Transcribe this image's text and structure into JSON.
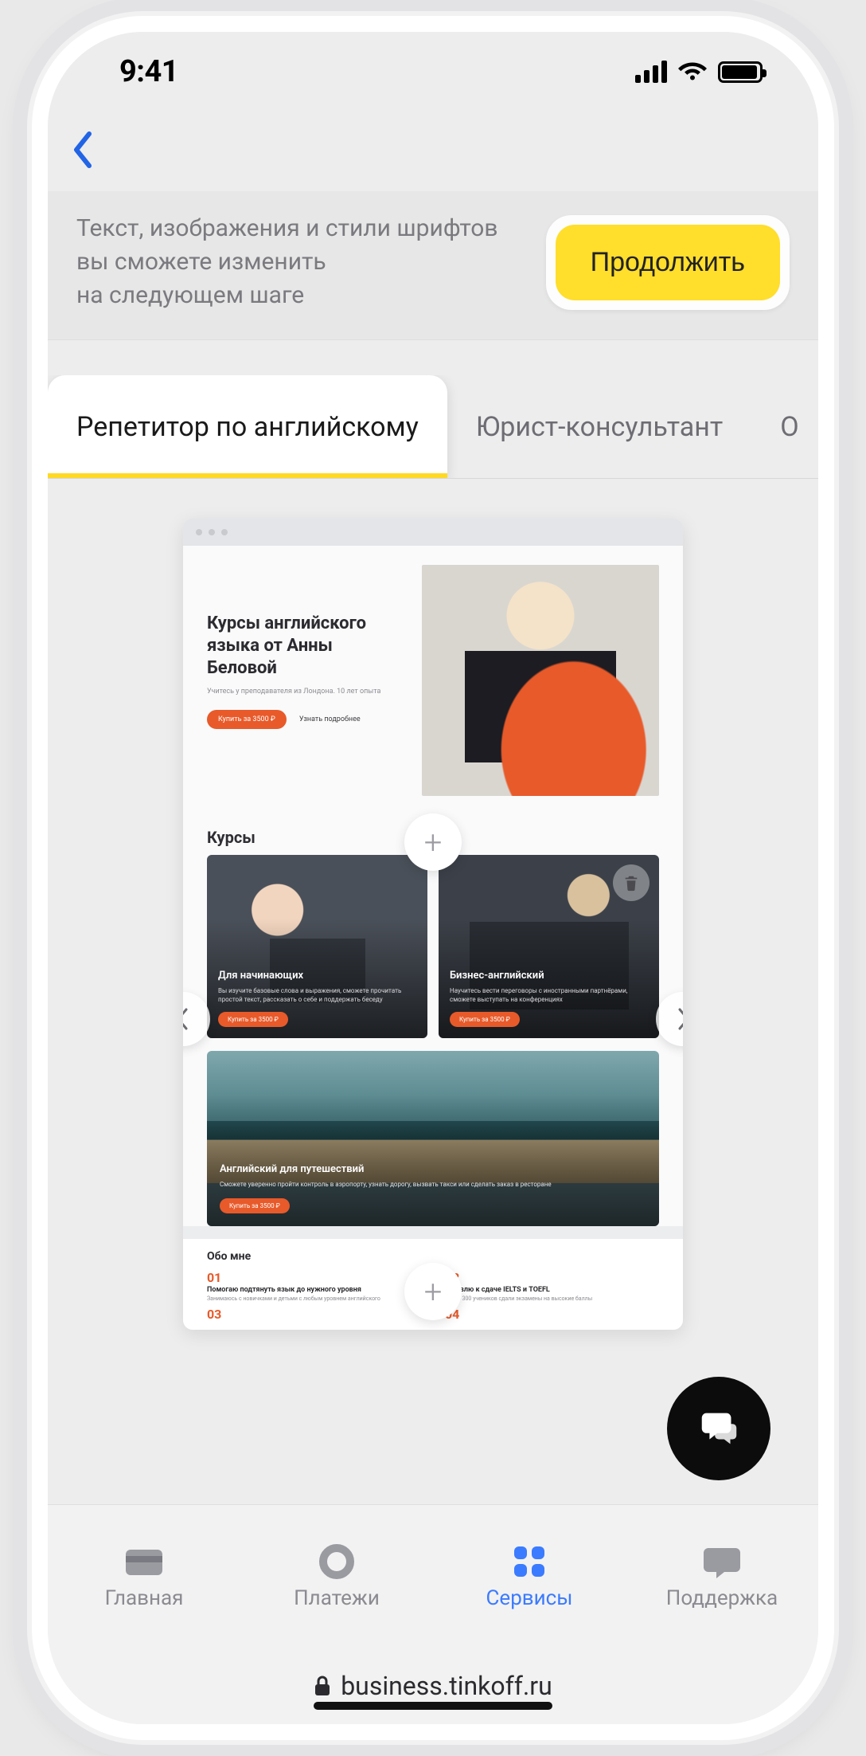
{
  "status": {
    "time": "9:41"
  },
  "banner": {
    "text_lines": [
      "Текст, изображения и стили шрифтов",
      "вы сможете изменить",
      "на следующем шаге"
    ],
    "continue_label": "Продолжить"
  },
  "tabs": {
    "items": [
      {
        "label": "Репетитор по английскому",
        "active": true
      },
      {
        "label": "Юрист-консультант",
        "active": false
      },
      {
        "label": "О",
        "active": false
      }
    ]
  },
  "preview": {
    "hero": {
      "title": "Курсы английского языка от Анны Беловой",
      "subtitle": "Учитесь у преподавателя из Лондона. 10 лет опыта",
      "primary_btn": "Купить за 3500 ₽",
      "secondary_btn": "Узнать подробнее"
    },
    "courses_heading": "Курсы",
    "courses": [
      {
        "title": "Для начинающих",
        "desc": "Вы изучите базовые слова и выражения, сможете прочитать простой текст, рассказать о себе и поддержать беседу",
        "btn": "Купить за 3500 ₽"
      },
      {
        "title": "Бизнес-английский",
        "desc": "Научитесь вести переговоры с иностранными партнёрами, сможете выступать на конференциях",
        "btn": "Купить за 3500 ₽"
      }
    ],
    "wide_course": {
      "title": "Английский для путешествий",
      "desc": "Сможете уверенно пройти контроль в аэропорту, узнать дорогу, вызвать такси или сделать заказ в ресторане",
      "btn": "Купить за 3500 ₽"
    },
    "about": {
      "heading": "Обо мне",
      "items": [
        {
          "num": "01",
          "line1": "Помогаю подтянуть язык до нужного уровня",
          "line2": "Занимаюсь с новичками и детьми с любым уровнем английского"
        },
        {
          "num": "02",
          "line1": "Готовлю к сдаче IELTS и TOEFL",
          "line2": "Более 300 учеников сдали экзамены на высокие баллы"
        },
        {
          "num": "03",
          "line1": "",
          "line2": ""
        },
        {
          "num": "04",
          "line1": "",
          "line2": ""
        }
      ]
    }
  },
  "bottom_tabs": {
    "items": [
      {
        "label": "Главная",
        "icon": "card-icon",
        "active": false
      },
      {
        "label": "Платежи",
        "icon": "circle-icon",
        "active": false
      },
      {
        "label": "Сервисы",
        "icon": "grid-icon",
        "active": true
      },
      {
        "label": "Поддержка",
        "icon": "support-icon",
        "active": false
      }
    ]
  },
  "url_bar": {
    "host": "business.tinkoff.ru"
  }
}
